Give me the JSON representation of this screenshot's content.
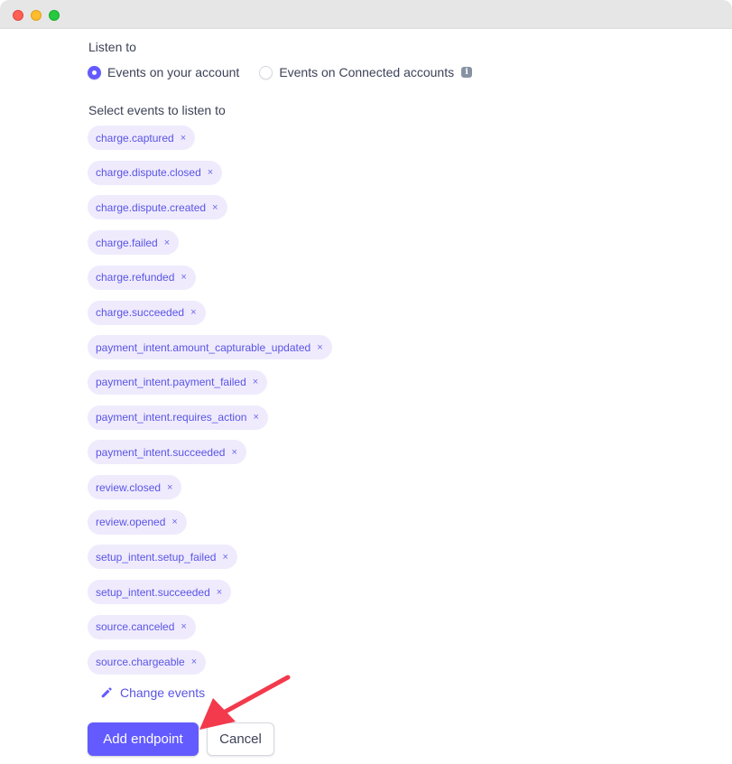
{
  "window": {
    "controls": [
      "close",
      "minimize",
      "maximize"
    ]
  },
  "listen_to": {
    "label": "Listen to",
    "options": [
      {
        "label": "Events on your account",
        "selected": true
      },
      {
        "label": "Events on Connected accounts",
        "selected": false,
        "icon": "info-icon"
      }
    ]
  },
  "events": {
    "label": "Select events to listen to",
    "remove_glyph": "×",
    "selected": [
      "charge.captured",
      "charge.dispute.closed",
      "charge.dispute.created",
      "charge.failed",
      "charge.refunded",
      "charge.succeeded",
      "payment_intent.amount_capturable_updated",
      "payment_intent.payment_failed",
      "payment_intent.requires_action",
      "payment_intent.succeeded",
      "review.closed",
      "review.opened",
      "setup_intent.setup_failed",
      "setup_intent.succeeded",
      "source.canceled",
      "source.chargeable"
    ],
    "change_label": "Change events",
    "change_icon": "pencil-icon"
  },
  "actions": {
    "primary_label": "Add endpoint",
    "secondary_label": "Cancel"
  },
  "annotation": {
    "type": "arrow",
    "points_to": "add-endpoint-button",
    "color": "#f23a4c"
  },
  "colors": {
    "accent": "#635bff",
    "chip_bg": "#efebfd",
    "chip_text": "#5a54e4",
    "text": "#3c4257"
  }
}
